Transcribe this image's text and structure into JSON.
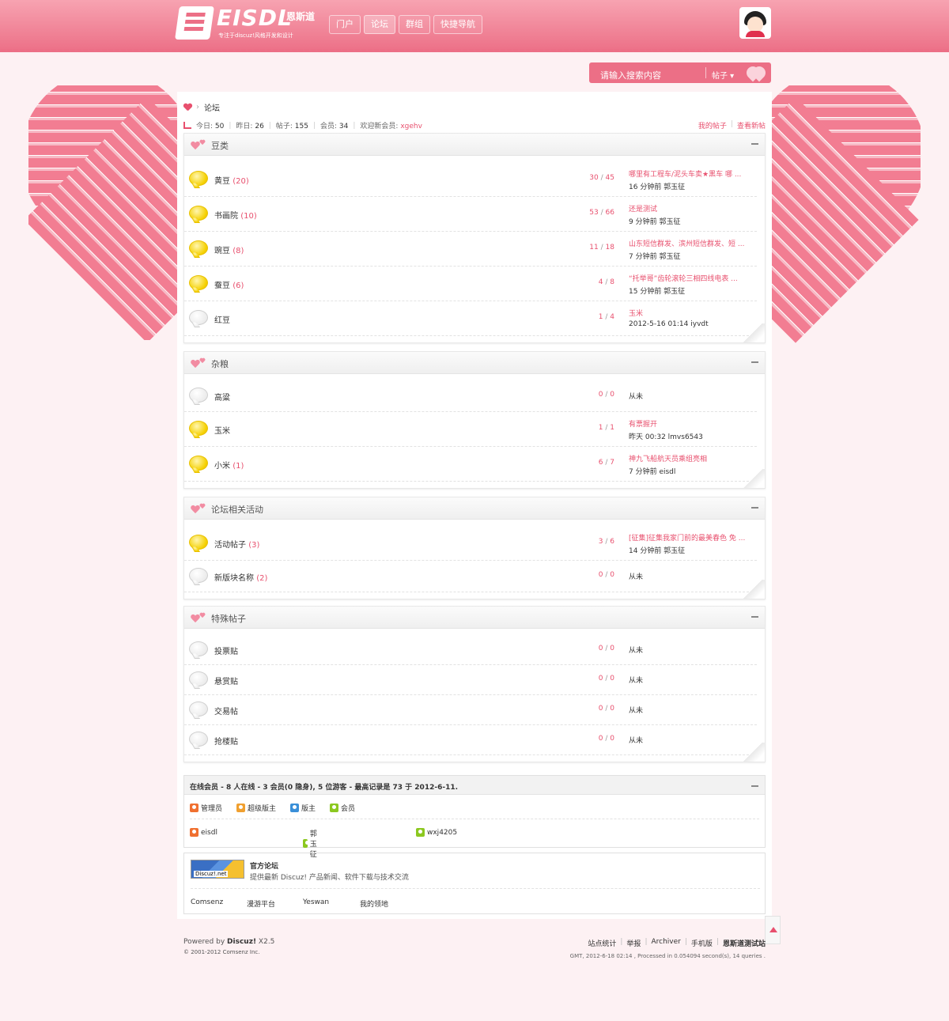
{
  "header": {
    "logo_text": "EISDL",
    "logo_cn": "恩斯道",
    "logo_sub": "专注于discuz!风格开发和设计",
    "nav": [
      "门户",
      "论坛",
      "群组",
      "快捷导航"
    ]
  },
  "search": {
    "placeholder": "请输入搜索内容",
    "type": "帖子"
  },
  "breadcrumb": {
    "current": "论坛"
  },
  "stats": {
    "today_label": "今日:",
    "today": "50",
    "yesterday_label": "昨日:",
    "yesterday": "26",
    "posts_label": "帖子:",
    "posts": "155",
    "members_label": "会员:",
    "members": "34",
    "welcome_label": "欢迎新会员:",
    "newest_member": "xgehv"
  },
  "toplinks": {
    "my_posts": "我的帖子",
    "new_posts": "查看新帖"
  },
  "sections": [
    {
      "title": "豆类",
      "forums": [
        {
          "name": "黄豆",
          "today": "(20)",
          "threads": "30",
          "posts": "45",
          "last_title": "哪里有工程车/泥头车卖★黑车 哪 ...",
          "last_meta": "16 分钟前 郭玉征",
          "active": true
        },
        {
          "name": "书画院",
          "today": "(10)",
          "threads": "53",
          "posts": "66",
          "last_title": "还是测试",
          "last_meta": "9 分钟前 郭玉征",
          "active": true
        },
        {
          "name": "豌豆",
          "today": "(8)",
          "threads": "11",
          "posts": "18",
          "last_title": "山东短信群发、滨州短信群发、短 ...",
          "last_meta": "7 分钟前 郭玉征",
          "active": true
        },
        {
          "name": "蚕豆",
          "today": "(6)",
          "threads": "4",
          "posts": "8",
          "last_title": "“托举哥”齿轮滚轮三相四线电表 ...",
          "last_meta": "15 分钟前 郭玉征",
          "active": true
        },
        {
          "name": "红豆",
          "today": "",
          "threads": "1",
          "posts": "4",
          "last_title": "玉米",
          "last_meta": "2012-5-16 01:14 iyvdt",
          "active": false
        }
      ]
    },
    {
      "title": "杂粮",
      "forums": [
        {
          "name": "高粱",
          "today": "",
          "threads": "0",
          "posts": "0",
          "last_title": "",
          "last_meta": "从未",
          "active": false
        },
        {
          "name": "玉米",
          "today": "",
          "threads": "1",
          "posts": "1",
          "last_title": "有票握开",
          "last_meta": "昨天 00:32 lmvs6543",
          "active": true
        },
        {
          "name": "小米",
          "today": "(1)",
          "threads": "6",
          "posts": "7",
          "last_title": "神九飞船航天员乘组亮相",
          "last_meta": "7 分钟前 eisdl",
          "active": true
        }
      ]
    },
    {
      "title": "论坛相关活动",
      "forums": [
        {
          "name": "活动帖子",
          "today": "(3)",
          "threads": "3",
          "posts": "6",
          "last_title": "[征集]征集我家门前的最美春色 免 ...",
          "last_meta": "14 分钟前 郭玉征",
          "active": true
        },
        {
          "name": "新版块名称",
          "today": "(2)",
          "threads": "0",
          "posts": "0",
          "last_title": "",
          "last_meta": "从未",
          "active": false
        }
      ]
    },
    {
      "title": "特殊帖子",
      "forums": [
        {
          "name": "投票贴",
          "today": "",
          "threads": "0",
          "posts": "0",
          "last_title": "",
          "last_meta": "从未",
          "active": false
        },
        {
          "name": "悬赏贴",
          "today": "",
          "threads": "0",
          "posts": "0",
          "last_title": "",
          "last_meta": "从未",
          "active": false
        },
        {
          "name": "交易帖",
          "today": "",
          "threads": "0",
          "posts": "0",
          "last_title": "",
          "last_meta": "从未",
          "active": false
        },
        {
          "name": "抢楼贴",
          "today": "",
          "threads": "0",
          "posts": "0",
          "last_title": "",
          "last_meta": "从未",
          "active": false
        }
      ]
    }
  ],
  "online": {
    "title": "在线会员 - 8 人在线 - 3 会员(0 隐身), 5 位游客 - 最高记录是 73 于 2012-6-11.",
    "legend": [
      {
        "label": "管理员",
        "color": "#f07030"
      },
      {
        "label": "超级版主",
        "color": "#f0a030"
      },
      {
        "label": "版主",
        "color": "#3a8fd8"
      },
      {
        "label": "会员",
        "color": "#8cc820"
      }
    ],
    "users": [
      {
        "name": "eisdl",
        "color": "#f07030"
      },
      {
        "name": "郭玉征",
        "color": "#8cc820"
      },
      {
        "name": "wxj4205",
        "color": "#8cc820"
      }
    ]
  },
  "links": {
    "logo_text": "Discuz!.net",
    "title": "官方论坛",
    "desc": "提供最新 Discuz! 产品新闻、软件下载与技术交流",
    "items": [
      "Comsenz",
      "漫游平台",
      "Yeswan",
      "我的领地"
    ]
  },
  "footer": {
    "powered_by": "Powered by",
    "product": "Discuz!",
    "version": "X2.5",
    "copyright": "© 2001-2012 Comsenz Inc.",
    "links": [
      "站点统计",
      "举报",
      "Archiver",
      "手机版",
      "恩斯道测试站"
    ],
    "processed": "GMT, 2012-6-18 02:14 , Processed in 0.054094 second(s), 14 queries ."
  }
}
